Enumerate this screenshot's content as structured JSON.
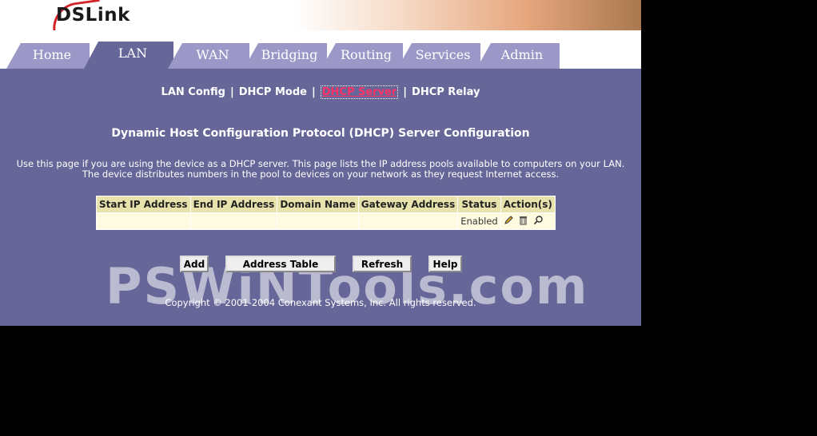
{
  "brand": {
    "logo_text": "DSLink"
  },
  "tabs": [
    {
      "label": "Home",
      "active": false
    },
    {
      "label": "LAN",
      "active": true
    },
    {
      "label": "WAN",
      "active": false
    },
    {
      "label": "Bridging",
      "active": false
    },
    {
      "label": "Routing",
      "active": false
    },
    {
      "label": "Services",
      "active": false
    },
    {
      "label": "Admin",
      "active": false
    }
  ],
  "subnav": {
    "items": [
      "LAN Config",
      "DHCP Mode",
      "DHCP Server",
      "DHCP Relay"
    ],
    "current_index": 2
  },
  "page": {
    "heading": "Dynamic Host Configuration Protocol (DHCP) Server Configuration",
    "description_line1": "Use this page if you are using the device as a DHCP server. This page lists the IP address pools available to computers on your LAN.",
    "description_line2": "The device distributes numbers in the pool to devices on your network as they request Internet access."
  },
  "table": {
    "columns": [
      "Start IP Address",
      "End IP Address",
      "Domain Name",
      "Gateway Address",
      "Status",
      "Action(s)"
    ],
    "rows": [
      {
        "start_ip": "",
        "end_ip": "",
        "domain": "",
        "gateway": "",
        "status": "Enabled"
      }
    ]
  },
  "buttons": {
    "add": "Add",
    "address_table": "Address Table",
    "refresh": "Refresh",
    "help": "Help"
  },
  "footer": {
    "copyright": "Copyright © 2001-2004 Conexant Systems, Inc. All rights reserved."
  },
  "watermark": {
    "text": "PSWiNTools.com"
  },
  "colors": {
    "panel": "#666699",
    "tab": "#9b98c8",
    "current_link": "#ff3366",
    "table_header": "#e8e2ad"
  }
}
